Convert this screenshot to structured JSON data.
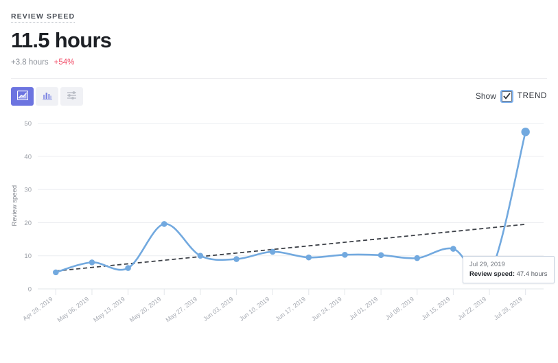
{
  "header": {
    "metric_label": "REVIEW SPEED",
    "metric_value": "11.5 hours",
    "delta_absolute": "+3.8 hours",
    "delta_percent": "+54%"
  },
  "toolbar": {
    "chart_types": [
      {
        "name": "area-chart",
        "label": "Area chart",
        "active": true
      },
      {
        "name": "bar-chart",
        "label": "Bar chart",
        "active": false
      },
      {
        "name": "settings-sliders",
        "label": "Chart settings",
        "active": false
      }
    ],
    "show_label": "Show",
    "trend_label": "TREND",
    "trend_checked": true
  },
  "tooltip": {
    "date": "Jul 29, 2019",
    "metric_name": "Review speed:",
    "value": "47.4 hours"
  },
  "colors": {
    "series": "#72a9df",
    "trend": "#3d4148",
    "accent": "#6c74e0",
    "delta_positive": "#f2536d",
    "grid": "#eceef1"
  },
  "chart_data": {
    "type": "line",
    "title": "",
    "xlabel": "",
    "ylabel": "Review speed",
    "ylim": [
      0,
      52
    ],
    "yticks": [
      0,
      10,
      20,
      30,
      40,
      50
    ],
    "grid": true,
    "legend": "none",
    "curve": "smooth",
    "categories": [
      "Apr 29, 2019",
      "May 06, 2019",
      "May 13, 2019",
      "May 20, 2019",
      "May 27, 2019",
      "Jun 03, 2019",
      "Jun 10, 2019",
      "Jun 17, 2019",
      "Jun 24, 2019",
      "Jul 01, 2019",
      "Jul 08, 2019",
      "Jul 15, 2019",
      "Jul 22, 2019",
      "Jul 29, 2019"
    ],
    "series": [
      {
        "name": "Review speed",
        "type": "line",
        "color": "#72a9df",
        "values": [
          5.0,
          8.0,
          6.3,
          19.6,
          10.0,
          9.0,
          11.2,
          9.5,
          10.3,
          10.2,
          9.3,
          12.1,
          4.4,
          47.4
        ]
      },
      {
        "name": "Trend",
        "type": "trendline",
        "style": "dashed",
        "color": "#3d4148",
        "values": [
          5.4,
          6.5,
          7.5,
          8.6,
          9.6,
          10.7,
          11.7,
          12.8,
          13.8,
          14.9,
          15.9,
          17.0,
          18.0,
          19.5
        ]
      }
    ],
    "highlighted_point": {
      "category": "Jul 29, 2019",
      "value": 47.4
    }
  }
}
